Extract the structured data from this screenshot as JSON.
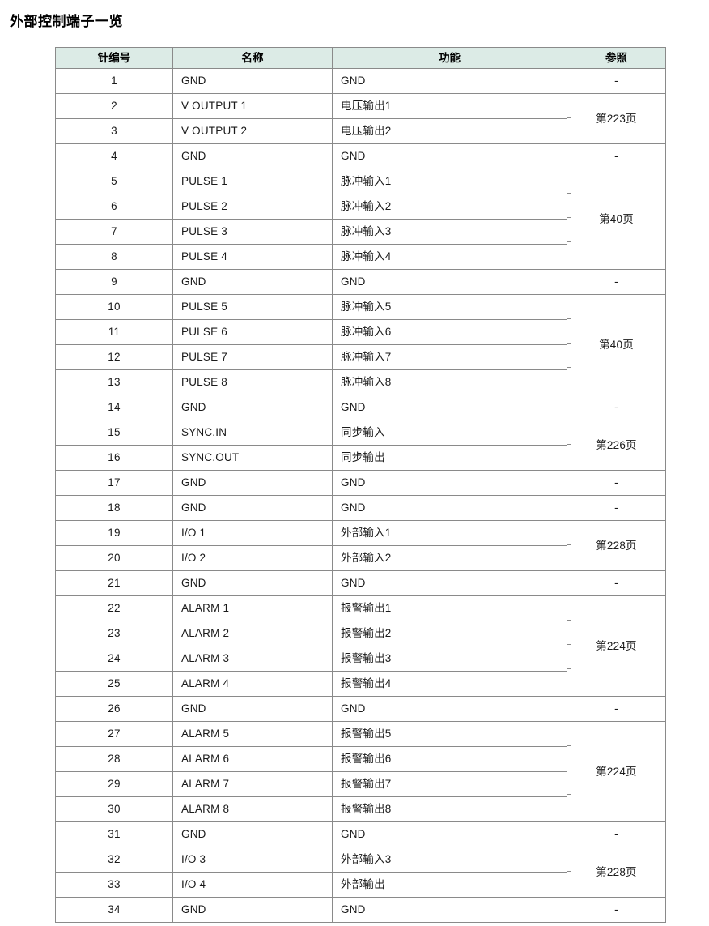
{
  "document": {
    "title": "外部控制端子一览"
  },
  "table": {
    "headers": {
      "pin": "针编号",
      "name": "名称",
      "function": "功能",
      "reference": "参照"
    },
    "colors": {
      "header_background": "#dcebe6",
      "border": "#8a8a8a",
      "text": "#1a1a1a",
      "page_background": "#ffffff"
    },
    "rows": [
      {
        "pin": "1",
        "name": "GND",
        "function": "GND",
        "reference": "-",
        "ref_rowspan": 1
      },
      {
        "pin": "2",
        "name": "V OUTPUT 1",
        "function": "电压输出1",
        "reference": "第223页",
        "ref_rowspan": 2
      },
      {
        "pin": "3",
        "name": "V OUTPUT 2",
        "function": "电压输出2",
        "reference": null,
        "ref_rowspan": 0
      },
      {
        "pin": "4",
        "name": "GND",
        "function": "GND",
        "reference": "-",
        "ref_rowspan": 1
      },
      {
        "pin": "5",
        "name": "PULSE 1",
        "function": "脉冲输入1",
        "reference": "第40页",
        "ref_rowspan": 4
      },
      {
        "pin": "6",
        "name": "PULSE 2",
        "function": "脉冲输入2",
        "reference": null,
        "ref_rowspan": 0
      },
      {
        "pin": "7",
        "name": "PULSE 3",
        "function": "脉冲输入3",
        "reference": null,
        "ref_rowspan": 0
      },
      {
        "pin": "8",
        "name": "PULSE 4",
        "function": "脉冲输入4",
        "reference": null,
        "ref_rowspan": 0
      },
      {
        "pin": "9",
        "name": "GND",
        "function": "GND",
        "reference": "-",
        "ref_rowspan": 1
      },
      {
        "pin": "10",
        "name": "PULSE 5",
        "function": "脉冲输入5",
        "reference": "第40页",
        "ref_rowspan": 4
      },
      {
        "pin": "11",
        "name": "PULSE 6",
        "function": "脉冲输入6",
        "reference": null,
        "ref_rowspan": 0
      },
      {
        "pin": "12",
        "name": "PULSE 7",
        "function": "脉冲输入7",
        "reference": null,
        "ref_rowspan": 0
      },
      {
        "pin": "13",
        "name": "PULSE 8",
        "function": "脉冲输入8",
        "reference": null,
        "ref_rowspan": 0
      },
      {
        "pin": "14",
        "name": "GND",
        "function": "GND",
        "reference": "-",
        "ref_rowspan": 1
      },
      {
        "pin": "15",
        "name": "SYNC.IN",
        "function": "同步输入",
        "reference": "第226页",
        "ref_rowspan": 2
      },
      {
        "pin": "16",
        "name": "SYNC.OUT",
        "function": "同步输出",
        "reference": null,
        "ref_rowspan": 0
      },
      {
        "pin": "17",
        "name": "GND",
        "function": "GND",
        "reference": "-",
        "ref_rowspan": 1
      },
      {
        "pin": "18",
        "name": "GND",
        "function": "GND",
        "reference": "-",
        "ref_rowspan": 1
      },
      {
        "pin": "19",
        "name": "I/O 1",
        "function": "外部输入1",
        "reference": "第228页",
        "ref_rowspan": 2
      },
      {
        "pin": "20",
        "name": "I/O 2",
        "function": "外部输入2",
        "reference": null,
        "ref_rowspan": 0
      },
      {
        "pin": "21",
        "name": "GND",
        "function": "GND",
        "reference": "-",
        "ref_rowspan": 1
      },
      {
        "pin": "22",
        "name": "ALARM 1",
        "function": "报警输出1",
        "reference": "第224页",
        "ref_rowspan": 4
      },
      {
        "pin": "23",
        "name": "ALARM 2",
        "function": "报警输出2",
        "reference": null,
        "ref_rowspan": 0
      },
      {
        "pin": "24",
        "name": "ALARM 3",
        "function": "报警输出3",
        "reference": null,
        "ref_rowspan": 0
      },
      {
        "pin": "25",
        "name": "ALARM 4",
        "function": "报警输出4",
        "reference": null,
        "ref_rowspan": 0
      },
      {
        "pin": "26",
        "name": "GND",
        "function": "GND",
        "reference": "-",
        "ref_rowspan": 1
      },
      {
        "pin": "27",
        "name": "ALARM 5",
        "function": "报警输出5",
        "reference": "第224页",
        "ref_rowspan": 4
      },
      {
        "pin": "28",
        "name": "ALARM 6",
        "function": "报警输出6",
        "reference": null,
        "ref_rowspan": 0
      },
      {
        "pin": "29",
        "name": "ALARM 7",
        "function": "报警输出7",
        "reference": null,
        "ref_rowspan": 0
      },
      {
        "pin": "30",
        "name": "ALARM 8",
        "function": "报警输出8",
        "reference": null,
        "ref_rowspan": 0
      },
      {
        "pin": "31",
        "name": "GND",
        "function": "GND",
        "reference": "-",
        "ref_rowspan": 1
      },
      {
        "pin": "32",
        "name": "I/O 3",
        "function": "外部输入3",
        "reference": "第228页",
        "ref_rowspan": 2
      },
      {
        "pin": "33",
        "name": "I/O 4",
        "function": "外部输出",
        "reference": null,
        "ref_rowspan": 0
      },
      {
        "pin": "34",
        "name": "GND",
        "function": "GND",
        "reference": "-",
        "ref_rowspan": 1
      }
    ]
  }
}
